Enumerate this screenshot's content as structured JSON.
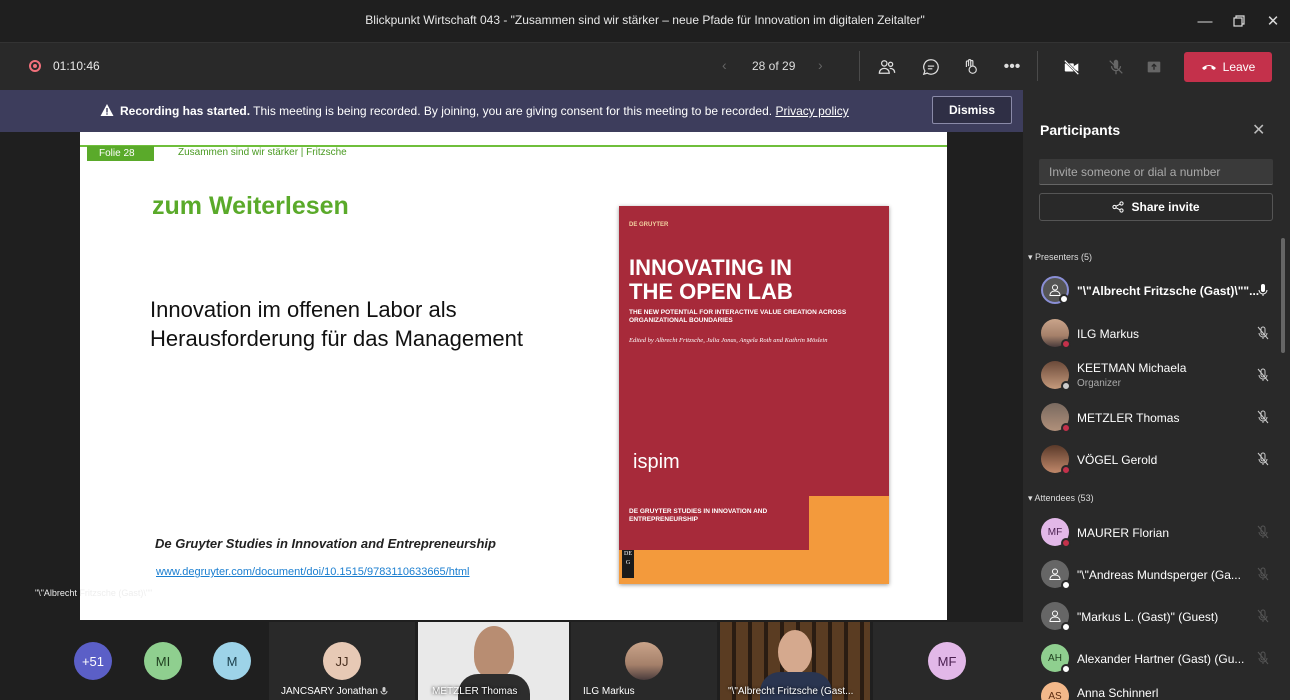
{
  "window": {
    "title": "Blickpunkt Wirtschaft 043 - \"Zusammen sind wir stärker – neue Pfade für Innovation im digitalen Zeitalter\""
  },
  "toolbar": {
    "timer": "01:10:46",
    "page_indicator": "28 of 29",
    "leave_label": "Leave"
  },
  "banner": {
    "strong": "Recording has started.",
    "text": " This meeting is being recorded. By joining, you are giving consent for this meeting to be recorded. ",
    "link": "Privacy policy",
    "dismiss_label": "Dismiss"
  },
  "slide": {
    "tag": "Folie 28",
    "subtitle": "Zusammen sind wir stärker | Fritzsche",
    "heading": "zum Weiterlesen",
    "body_line1": "Innovation im offenen Labor als",
    "body_line2": "Herausforderung für das Management",
    "series": "De Gruyter Studies in Innovation and Entrepreneurship",
    "link": "www.degruyter.com/document/doi/10.1515/9783110633665/html",
    "book": {
      "publisher": "DE GRUYTER",
      "title_line1": "INNOVATING IN",
      "title_line2": "THE OPEN LAB",
      "subtitle": "THE NEW POTENTIAL FOR INTERACTIVE VALUE CREATION ACROSS ORGANIZATIONAL BOUNDARIES",
      "editors": "Edited by Albrecht Fritzsche, Julia Jonas, Angela Roth and Kathrin Möslein",
      "logo": "ispim",
      "series": "DE GRUYTER STUDIES IN INNOVATION AND ENTREPRENEURSHIP",
      "spine": "DE G"
    }
  },
  "presenter_caption": "\"\\\"Albrecht Fritzsche (Gast)\\\"\"",
  "gallery": {
    "overflow": "+51",
    "tiles": [
      {
        "initials": "MI",
        "color": "#8fcf8f"
      },
      {
        "initials": "M",
        "color": "#9dd3e8"
      },
      {
        "initials": "JJ",
        "color": "#e7c9b5",
        "name": "JANCSARY Jonathan"
      },
      {
        "name": "METZLER Thomas"
      },
      {
        "name": "ILG Markus"
      },
      {
        "name": "\"\\\"Albrecht Fritzsche (Gast..."
      },
      {
        "initials": "MF",
        "color": "#e2b8e8"
      }
    ]
  },
  "participants": {
    "title": "Participants",
    "invite_placeholder": "Invite someone or dial a number",
    "share_label": "Share invite",
    "presenters_header": "Presenters (5)",
    "attendees_header": "Attendees (53)",
    "presenters": [
      {
        "name": "\"\\\"Albrecht Fritzsche (Gast)\\\"\"..."
      },
      {
        "name": "ILG Markus"
      },
      {
        "name": "KEETMAN Michaela",
        "role": "Organizer"
      },
      {
        "name": "METZLER Thomas"
      },
      {
        "name": "VÖGEL Gerold"
      }
    ],
    "attendees": [
      {
        "initials": "MF",
        "name": "MAURER Florian"
      },
      {
        "name": "\"\\\"Andreas Mundsperger (Ga..."
      },
      {
        "name": "\"Markus L. (Gast)\" (Guest)"
      },
      {
        "initials": "AH",
        "name": "Alexander Hartner (Gast) (Gu..."
      },
      {
        "initials": "AS",
        "name": "Anna Schinnerl"
      }
    ]
  },
  "colors": {
    "leave": "#c4314b",
    "banner": "#3d3d5c",
    "slide_accent": "#5aaa2a",
    "book_red": "#a72a3a",
    "book_orange": "#f39a3c"
  }
}
